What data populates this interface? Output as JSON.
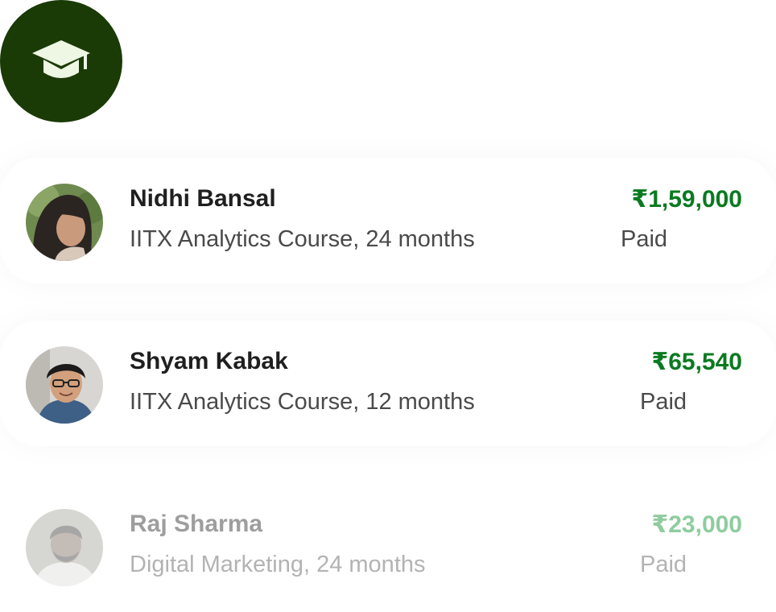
{
  "brand": {
    "icon": "graduation-cap-icon",
    "badge_color": "#1a3a06"
  },
  "payments": [
    {
      "name": "Nidhi Bansal",
      "course": "IITX Analytics Course, 24 months",
      "amount": "₹1,59,000",
      "status": "Paid"
    },
    {
      "name": "Shyam Kabak",
      "course": "IITX Analytics Course, 12 months",
      "amount": "₹65,540",
      "status": "Paid"
    },
    {
      "name": "Raj Sharma",
      "course": "Digital Marketing, 24 months",
      "amount": "₹23,000",
      "status": "Paid"
    }
  ],
  "colors": {
    "amount_green": "#0a7a20",
    "faded_amount_green": "#8fcc9e"
  }
}
